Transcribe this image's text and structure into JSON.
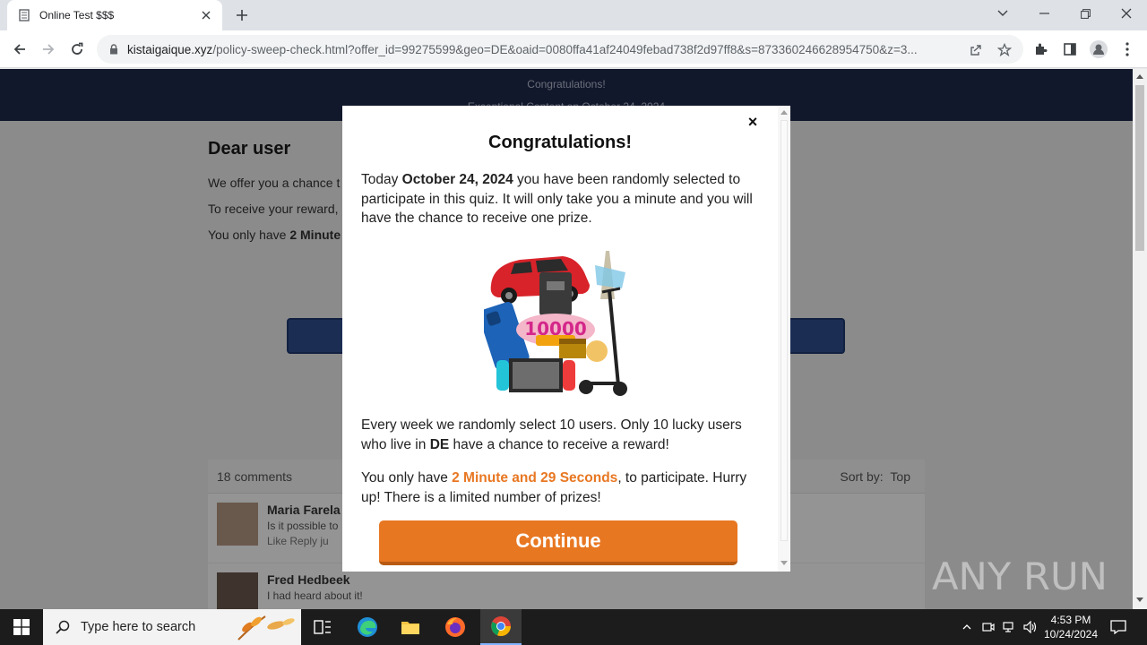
{
  "browser": {
    "tab_title": "Online Test $$$",
    "url_host": "kistaigaique.xyz",
    "url_rest": "/policy-sweep-check.html?offer_id=99275599&geo=DE&oaid=0080ffa41af24049febad738f2d97ff8&s=873360246628954750&z=3..."
  },
  "page": {
    "header_line1": "Congratulations!",
    "header_line2": "Exceptional Content on October 24, 2024",
    "heading": "Dear user",
    "p1": "We offer you a chance t",
    "p2": "To receive your reward,",
    "p3_prefix": "You only have ",
    "p3_bold": "2 Minute",
    "comments_count": "18 comments",
    "sort_label": "Sort by:",
    "sort_value": "Top",
    "comments": [
      {
        "name": "Maria Farela",
        "text": "Is it possible to",
        "meta": "Like Reply  ju"
      },
      {
        "name": "Fred Hedbeek",
        "text": "I had heard about it!",
        "meta": ""
      }
    ]
  },
  "modal": {
    "title": "Congratulations!",
    "p1_prefix": "Today ",
    "p1_date": "October 24, 2024",
    "p1_suffix": " you have been randomly selected to participate in this quiz. It will only take you a minute and you will have the chance to receive one prize.",
    "prize_badge_text": "10000",
    "p2_prefix": "Every week we randomly select 10 users. Only 10 lucky users who live in ",
    "p2_country": "DE",
    "p2_suffix": " have a chance to receive a reward!",
    "p3_prefix": "You only have ",
    "p3_timer": "2 Minute and 29 Seconds",
    "p3_suffix": ", to participate. Hurry up! There is a limited number of prizes!",
    "continue_label": "Continue",
    "close_glyph": "×"
  },
  "watermark": {
    "text": "ANY RUN"
  },
  "taskbar": {
    "search_placeholder": "Type here to search",
    "time": "4:53 PM",
    "date": "10/24/2024"
  },
  "colors": {
    "accent_orange": "#e87722",
    "header_navy": "#1f2a4d"
  }
}
